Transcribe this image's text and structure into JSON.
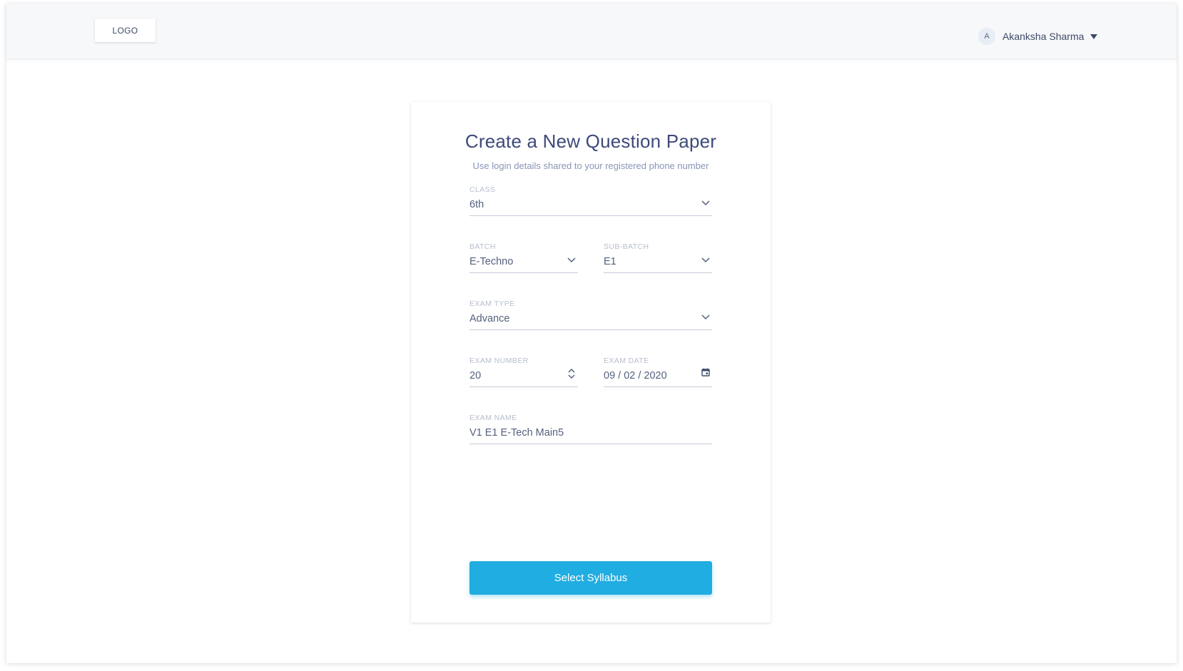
{
  "header": {
    "logo_text": "LOGO",
    "user": {
      "avatar_initial": "A",
      "name": "Akanksha Sharma"
    }
  },
  "form": {
    "title": "Create a New Question Paper",
    "subtitle": "Use login details shared to your registered phone number",
    "fields": {
      "class": {
        "label": "CLASS",
        "value": "6th"
      },
      "batch": {
        "label": "BATCH",
        "value": "E-Techno"
      },
      "sub_batch": {
        "label": "SUB-BATCH",
        "value": "E1"
      },
      "exam_type": {
        "label": "EXAM TYPE",
        "value": "Advance"
      },
      "exam_number": {
        "label": "EXAM NUMBER",
        "value": "20"
      },
      "exam_date": {
        "label": "EXAM DATE",
        "value": "09 / 02 / 2020"
      },
      "exam_name": {
        "label": "EXAM NAME",
        "value": "V1 E1 E-Tech Main5"
      }
    },
    "submit_label": "Select Syllabus"
  },
  "colors": {
    "accent": "#20ade1",
    "title": "#3d4a7a",
    "text": "#55607e",
    "label": "#b6bdcc"
  },
  "icons": {
    "dropdown": "chevron-down-icon",
    "number": "stepper-icon",
    "date": "calendar-icon",
    "user_menu": "caret-down-icon"
  }
}
